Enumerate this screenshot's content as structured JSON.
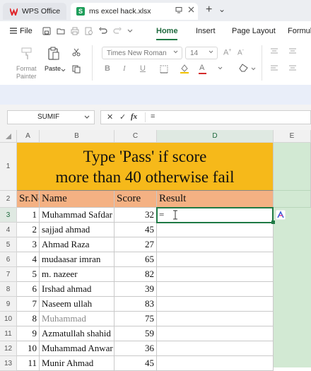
{
  "titlebar": {
    "app_tab": "WPS Office",
    "file_tab": "ms excel hack.xlsx",
    "file_icon_letter": "S",
    "new_tab": "+",
    "tab_menu": "⌄"
  },
  "menu": {
    "file": "File",
    "tabs": [
      "Home",
      "Insert",
      "Page Layout",
      "Formul"
    ]
  },
  "ribbon": {
    "format_painter_line1": "Format",
    "format_painter_line2": "Painter",
    "paste_label": "Paste",
    "font_name": "Times New Roman",
    "font_size": "14",
    "bold": "B",
    "italic": "I",
    "underline": "U",
    "font_color": "A"
  },
  "formula_bar": {
    "name_box": "SUMIF",
    "cancel": "✕",
    "enter": "✓",
    "fx": "fx",
    "content": "="
  },
  "columns": [
    "A",
    "B",
    "C",
    "D",
    "E"
  ],
  "rows": [
    "1",
    "2",
    "3",
    "4",
    "5",
    "6",
    "7",
    "8",
    "9",
    "10",
    "11",
    "12",
    "13"
  ],
  "sheet": {
    "title_line1": "Type 'Pass' if score",
    "title_line2": "more than 40 otherwise fail",
    "headers": [
      "Sr.No",
      "Name",
      "Score",
      "Result"
    ],
    "active_cell_value": "=",
    "records": [
      {
        "sr": "1",
        "name": "Muhammad Safdar",
        "score": "32"
      },
      {
        "sr": "2",
        "name": "sajjad ahmad",
        "score": "45"
      },
      {
        "sr": "3",
        "name": "Ahmad Raza",
        "score": "27"
      },
      {
        "sr": "4",
        "name": "mudaasar imran",
        "score": "65"
      },
      {
        "sr": "5",
        "name": "m. nazeer",
        "score": "82"
      },
      {
        "sr": "6",
        "name": "Irshad ahmad",
        "score": "39"
      },
      {
        "sr": "7",
        "name": "Naseem ullah",
        "score": "83"
      },
      {
        "sr": "8",
        "name": "Muhammad",
        "score": "75"
      },
      {
        "sr": "9",
        "name": "Azmatullah shahid",
        "score": "59"
      },
      {
        "sr": "10",
        "name": "Muhammad Anwar",
        "score": "36"
      },
      {
        "sr": "11",
        "name": "Munir Ahmad",
        "score": "45"
      }
    ]
  },
  "colors": {
    "title_fill": "#f6b91a",
    "header_fill": "#f4b183",
    "accent_green": "#1f7a45",
    "side_green": "#d2e9d3"
  }
}
